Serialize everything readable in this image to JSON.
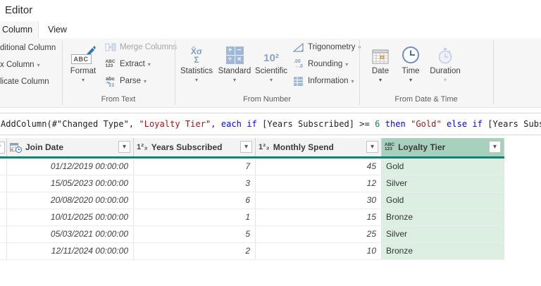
{
  "window": {
    "title": "Editor"
  },
  "tabs": {
    "column": "Column",
    "view": "View"
  },
  "ribbon": {
    "left_group": {
      "items": [
        "ditional Column",
        "x Column",
        "licate Column"
      ]
    },
    "from_text": {
      "label": "From Text",
      "format": "Format",
      "merge_columns": "Merge Columns",
      "extract": "Extract",
      "parse": "Parse"
    },
    "from_number": {
      "label": "From Number",
      "statistics": "Statistics",
      "standard": "Standard",
      "scientific": "Scientific",
      "trigonometry": "Trigonometry",
      "rounding": "Rounding",
      "information": "Information"
    },
    "from_date_time": {
      "label": "From Date & Time",
      "date": "Date",
      "time": "Time",
      "duration": "Duration"
    }
  },
  "icon_glyphs": {
    "number_type": "1²₃",
    "abc": "ABC",
    "onetwothree": "123",
    "abc_small": "abc",
    "statistics_top": "X̄σ",
    "statistics_bottom": "Σ",
    "scientific": "10²",
    "rounding_top": ".00",
    "rounding_bottom": "→.0",
    "standard_symbols": [
      "+",
      "−",
      "÷",
      "×"
    ]
  },
  "formula_bar": {
    "tokens": [
      {
        "text": "AddColumn(#\"Changed Type\", ",
        "color": "#1e1e1e"
      },
      {
        "text": "\"Loyalty Tier\"",
        "color": "#a31515"
      },
      {
        "text": ", ",
        "color": "#1e1e1e"
      },
      {
        "text": "each",
        "color": "#0000ff"
      },
      {
        "text": " ",
        "color": "#1e1e1e"
      },
      {
        "text": "if",
        "color": "#0000ff"
      },
      {
        "text": " [Years Subscribed] >= ",
        "color": "#1e1e1e"
      },
      {
        "text": "6",
        "color": "#098658"
      },
      {
        "text": " ",
        "color": "#1e1e1e"
      },
      {
        "text": "then",
        "color": "#0000ff"
      },
      {
        "text": " ",
        "color": "#1e1e1e"
      },
      {
        "text": "\"Gold\"",
        "color": "#a31515"
      },
      {
        "text": " ",
        "color": "#1e1e1e"
      },
      {
        "text": "else",
        "color": "#0000ff"
      },
      {
        "text": " ",
        "color": "#1e1e1e"
      },
      {
        "text": "if",
        "color": "#0000ff"
      },
      {
        "text": " [Years Subs",
        "color": "#1e1e1e"
      }
    ]
  },
  "table": {
    "columns": [
      {
        "name": "Join Date",
        "type": "datetime",
        "selected": false
      },
      {
        "name": "Years Subscribed",
        "type": "number",
        "selected": false
      },
      {
        "name": "Monthly Spend",
        "type": "number",
        "selected": false
      },
      {
        "name": "Loyalty Tier",
        "type": "any",
        "selected": true
      }
    ],
    "rows": [
      [
        "01/12/2019 00:00:00",
        "7",
        "45",
        "Gold"
      ],
      [
        "15/05/2023 00:00:00",
        "3",
        "12",
        "Silver"
      ],
      [
        "20/08/2020 00:00:00",
        "6",
        "30",
        "Gold"
      ],
      [
        "10/01/2025 00:00:00",
        "1",
        "15",
        "Bronze"
      ],
      [
        "05/03/2021 00:00:00",
        "5",
        "25",
        "Silver"
      ],
      [
        "12/11/2024 00:00:00",
        "2",
        "10",
        "Bronze"
      ]
    ]
  },
  "colors": {
    "accent_teal": "#0e8477",
    "selected_header_bg": "#a7d1bd",
    "selected_cell_bg": "#dcefe2",
    "keyword_blue": "#0000ff",
    "string_red": "#a31515",
    "number_green": "#098658",
    "ribbon_icon_blue": "#7f9cc0"
  }
}
